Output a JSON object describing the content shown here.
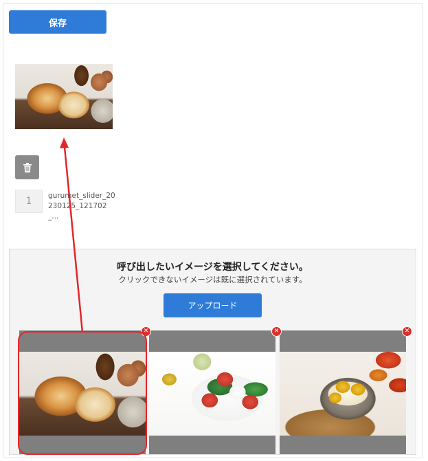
{
  "toolbar": {
    "save_label": "保存"
  },
  "selected": {
    "order": "1",
    "file_name": "gurumet_slider_20230125_121702_..."
  },
  "picker": {
    "title": "呼び出したいイメージを選択してください。",
    "subtitle": "クリックできないイメージは既に選択されています。",
    "upload_label": "アップロード",
    "images": [
      {
        "icon": "bread-photo"
      },
      {
        "icon": "caprese-salad-photo"
      },
      {
        "icon": "chestnut-rice-photo"
      }
    ]
  },
  "annotation": {
    "highlight_color": "#e2262a",
    "arrow_color": "#e2262a"
  },
  "colors": {
    "primary": "#2f7bd8",
    "danger": "#d9302c",
    "trash_bg": "#8a8a8a"
  }
}
